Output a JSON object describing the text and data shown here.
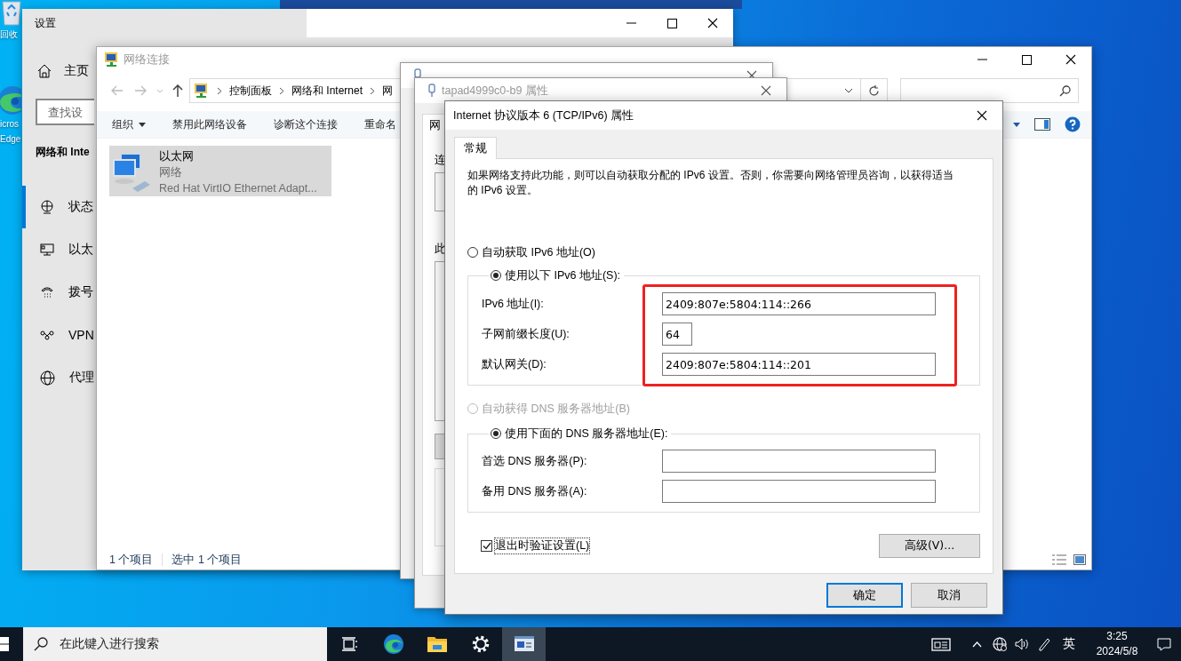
{
  "desktop": {
    "icons": [
      {
        "kind": "recycle",
        "lines": [
          "回收"
        ]
      },
      {
        "kind": "edge",
        "lines": [
          "icros",
          "Edge"
        ]
      }
    ]
  },
  "settings_window": {
    "title": "设置",
    "home": "主页",
    "search": {
      "placeholder": "查找设"
    },
    "heading": "网络和 Inte",
    "nav": [
      {
        "label": "状态",
        "selected": true
      },
      {
        "label": "以太",
        "selected": false
      },
      {
        "label": "拨号",
        "selected": false
      },
      {
        "label": "VPN",
        "selected": false
      },
      {
        "label": "代理",
        "selected": false
      }
    ]
  },
  "network_window": {
    "title": "网络连接",
    "breadcrumb": [
      "控制面板",
      "网络和 Internet",
      "网"
    ],
    "toolbar": [
      {
        "label": "组织",
        "dropdown": true
      },
      {
        "label": "禁用此网络设备",
        "dropdown": false
      },
      {
        "label": "诊断这个连接",
        "dropdown": false
      },
      {
        "label": "重命名",
        "dropdown": false
      }
    ],
    "items": [
      {
        "name": "以太网",
        "type": "网络",
        "device": "Red Hat VirtIO Ethernet Adapt...",
        "selected": true
      }
    ],
    "status": [
      "1 个项目",
      "选中 1 个项目"
    ]
  },
  "properties_window": {
    "title": "tapad4999c0-b9 属性",
    "fragments": [
      "网",
      "连",
      "此"
    ]
  },
  "ipv6_dialog": {
    "title": "Internet 协议版本 6 (TCP/IPv6) 属性",
    "tabs": [
      {
        "label": "常规",
        "selected": true
      }
    ],
    "description": "如果网络支持此功能，则可以自动获取分配的 IPv6 设置。否则，你需要向网络管理员咨询，以获得适当的 IPv6 设置。",
    "address_mode": [
      {
        "label": "自动获取 IPv6 地址(O)",
        "selected": false,
        "disabled": false
      },
      {
        "label": "使用以下 IPv6 地址(S):",
        "selected": true,
        "disabled": false
      }
    ],
    "address_fields": [
      {
        "label": "IPv6 地址(I):",
        "value": "2409:807e:5804:114::266",
        "kind": "address"
      },
      {
        "label": "子网前缀长度(U):",
        "value": "64",
        "kind": "prefix"
      },
      {
        "label": "默认网关(D):",
        "value": "2409:807e:5804:114::201",
        "kind": "address"
      }
    ],
    "highlighted": true,
    "dns_mode": [
      {
        "label": "自动获得 DNS 服务器地址(B)",
        "selected": false,
        "disabled": true
      },
      {
        "label": "使用下面的 DNS 服务器地址(E):",
        "selected": true,
        "disabled": false
      }
    ],
    "dns_fields": [
      {
        "label": "首选 DNS 服务器(P):",
        "kind": "address"
      },
      {
        "label": "备用 DNS 服务器(A):",
        "kind": "address"
      }
    ],
    "validate": {
      "label": "退出时验证设置(L)",
      "checked": true
    },
    "advanced": "高级(V)...",
    "buttons": [
      {
        "label": "确定",
        "default": true
      },
      {
        "label": "取消",
        "default": false
      }
    ]
  },
  "taskbar": {
    "search": {
      "placeholder": "在此键入进行搜索"
    },
    "apps": [
      {
        "kind": "taskview",
        "active": false
      },
      {
        "kind": "edge",
        "active": false
      },
      {
        "kind": "explorer",
        "active": false
      },
      {
        "kind": "settings",
        "active": false
      },
      {
        "kind": "network",
        "active": true
      }
    ],
    "tray": {
      "ime": "英",
      "time": "3:25",
      "date": "2024/5/8"
    }
  }
}
